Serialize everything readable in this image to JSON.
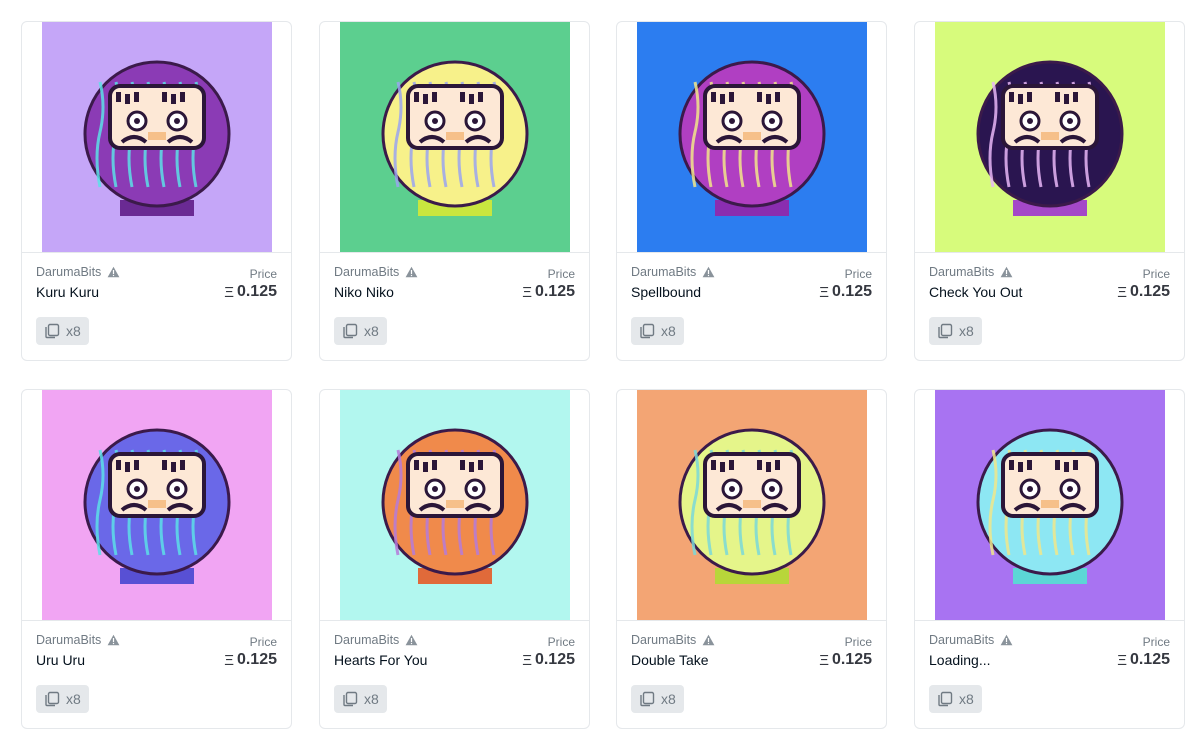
{
  "cards": [
    {
      "collection": "DarumaBits",
      "name": "Kuru Kuru",
      "price_label": "Price",
      "currency_icon": "Ξ",
      "price": "0.125",
      "editions": "x8",
      "colors": {
        "bg": "#c5a6f8",
        "body": "#8b3bb5",
        "accent": "#5ce0e6",
        "base": "#6a2a93",
        "face": "#fde8d6"
      }
    },
    {
      "collection": "DarumaBits",
      "name": "Niko Niko",
      "price_label": "Price",
      "currency_icon": "Ξ",
      "price": "0.125",
      "editions": "x8",
      "colors": {
        "bg": "#5ccf8f",
        "body": "#f7f18a",
        "accent": "#9aa5f0",
        "base": "#c9e63f",
        "face": "#fde8d6"
      }
    },
    {
      "collection": "DarumaBits",
      "name": "Spellbound",
      "price_label": "Price",
      "currency_icon": "Ξ",
      "price": "0.125",
      "editions": "x8",
      "colors": {
        "bg": "#2c7df0",
        "body": "#b03fc2",
        "accent": "#f2e68a",
        "base": "#8a2db0",
        "face": "#fde8d6"
      }
    },
    {
      "collection": "DarumaBits",
      "name": "Check You Out",
      "price_label": "Price",
      "currency_icon": "Ξ",
      "price": "0.125",
      "editions": "x8",
      "colors": {
        "bg": "#d7fb7c",
        "body": "#2a1550",
        "accent": "#e8b6f7",
        "base": "#a448c8",
        "face": "#fde8d6"
      }
    },
    {
      "collection": "DarumaBits",
      "name": "Uru Uru",
      "price_label": "Price",
      "currency_icon": "Ξ",
      "price": "0.125",
      "editions": "x8",
      "colors": {
        "bg": "#f1a5f3",
        "body": "#6a68e8",
        "accent": "#5cdfe8",
        "base": "#5850d4",
        "face": "#fde8d6"
      }
    },
    {
      "collection": "DarumaBits",
      "name": "Hearts For You",
      "price_label": "Price",
      "currency_icon": "Ξ",
      "price": "0.125",
      "editions": "x8",
      "colors": {
        "bg": "#b2f7ef",
        "body": "#f08a4b",
        "accent": "#b57ad9",
        "base": "#e06a3a",
        "face": "#fde8d6"
      }
    },
    {
      "collection": "DarumaBits",
      "name": "Double Take",
      "price_label": "Price",
      "currency_icon": "Ξ",
      "price": "0.125",
      "editions": "x8",
      "colors": {
        "bg": "#f3a574",
        "body": "#e5f58a",
        "accent": "#7ad8d8",
        "base": "#b8d63a",
        "face": "#fde8d6"
      }
    },
    {
      "collection": "DarumaBits",
      "name": "Loading...",
      "price_label": "Price",
      "currency_icon": "Ξ",
      "price": "0.125",
      "editions": "x8",
      "colors": {
        "bg": "#a873f2",
        "body": "#8de7f3",
        "accent": "#f0e68a",
        "base": "#5cd6d6",
        "face": "#fde8d6"
      }
    }
  ]
}
